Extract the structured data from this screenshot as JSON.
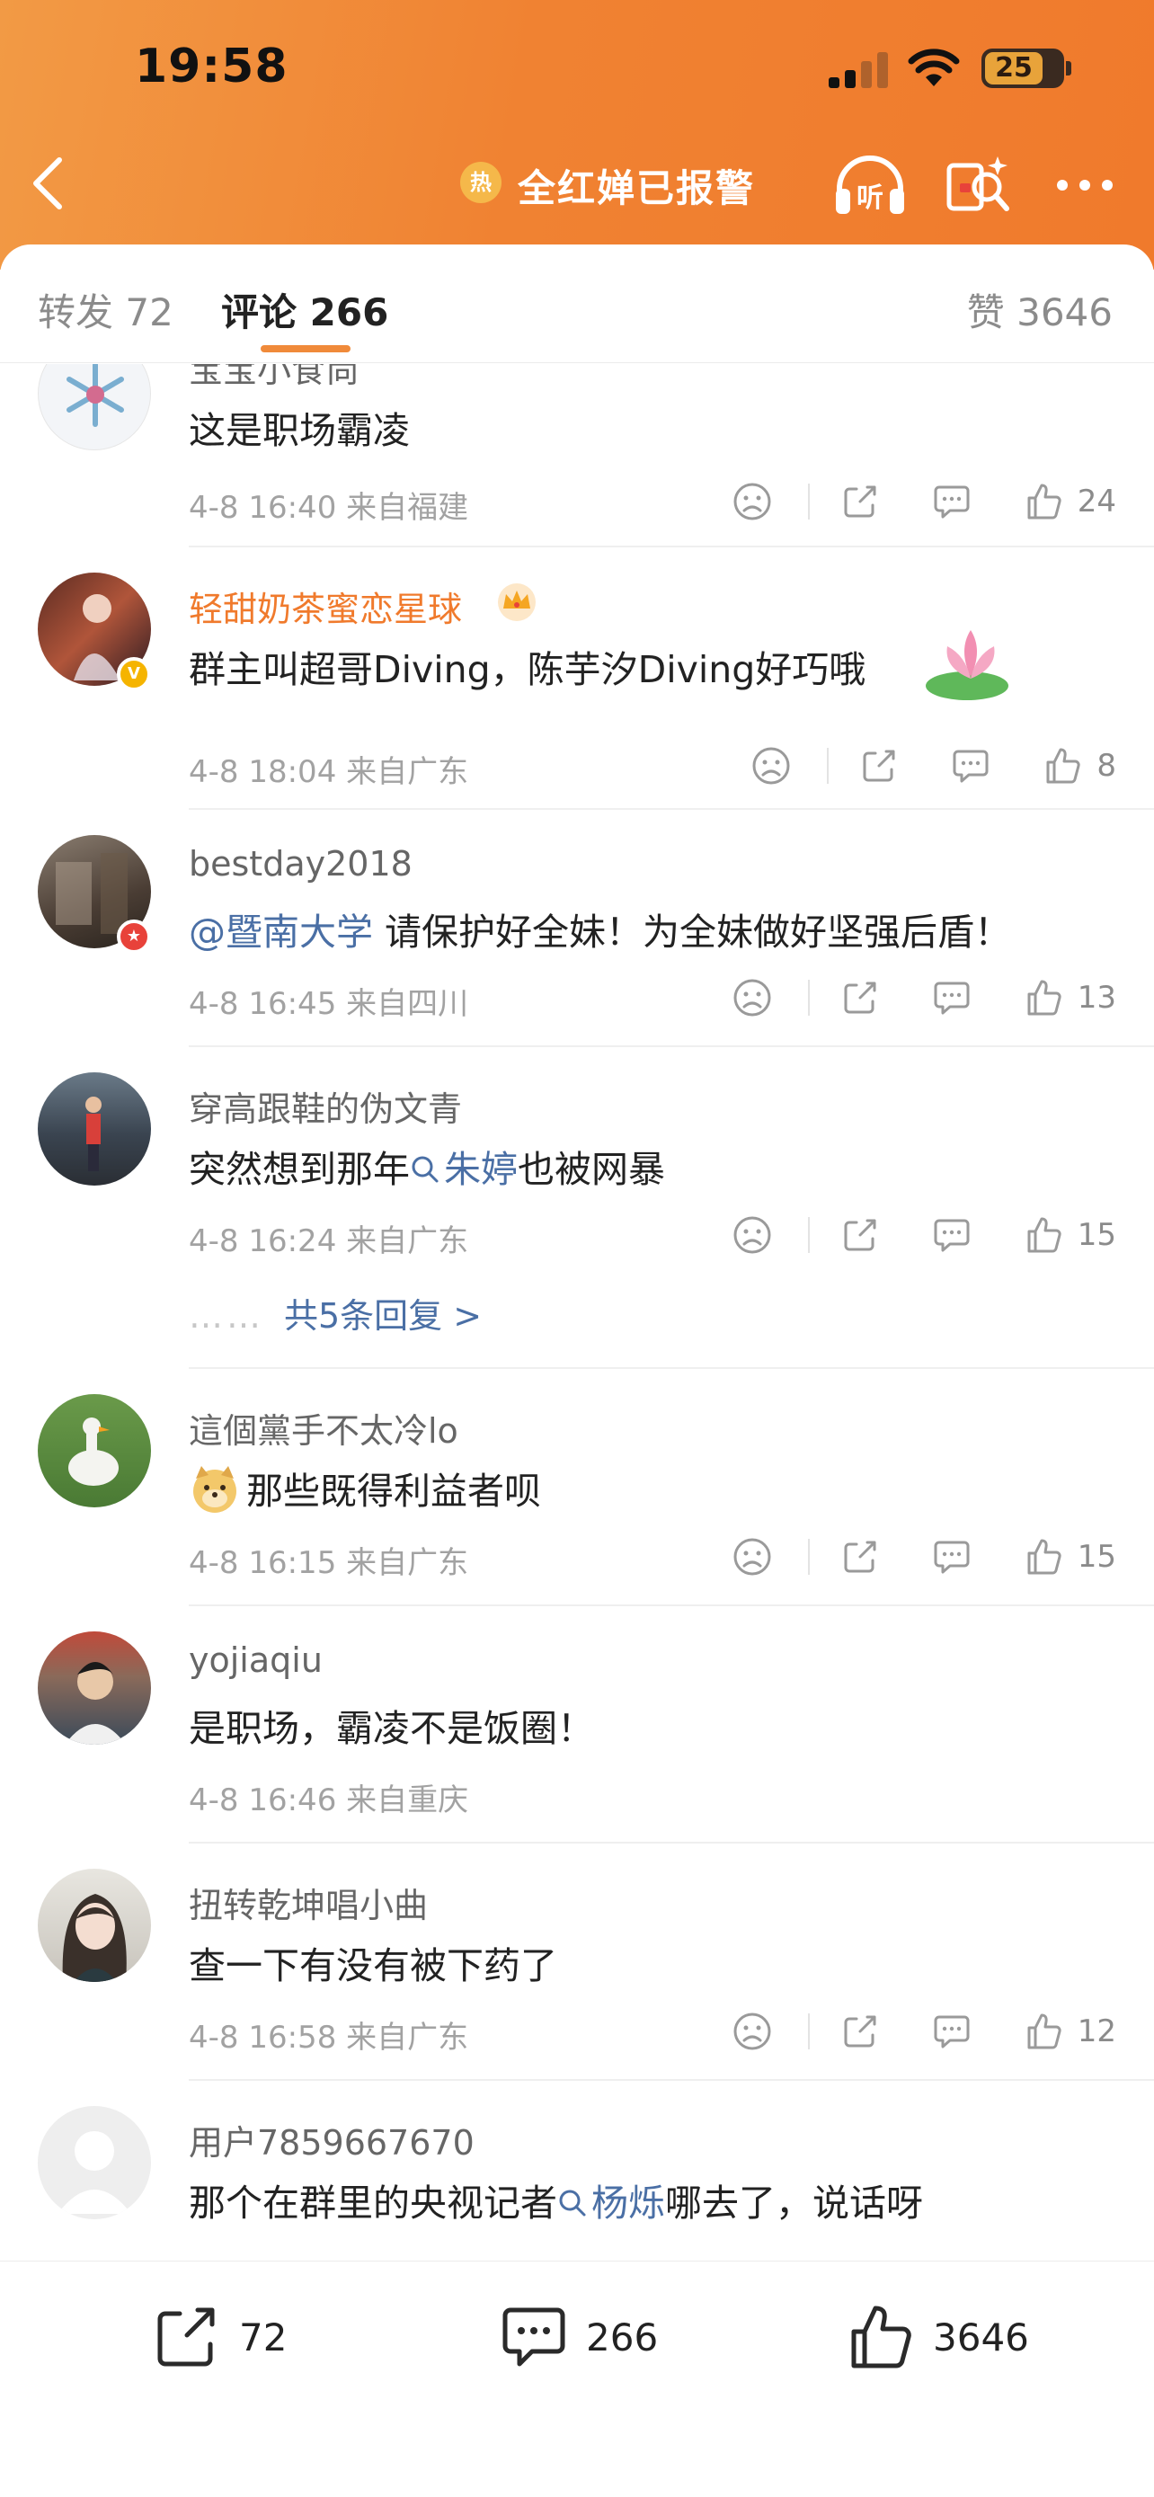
{
  "status_bar": {
    "time": "19:58",
    "battery": "25"
  },
  "nav": {
    "title": "全红婵已报警",
    "hot_badge": "热",
    "listen_icon": "listen-headphones-icon",
    "more_icon": "more-dots-icon"
  },
  "tabs": {
    "forward": "转发 72",
    "comment": "评论 266",
    "like": "赞 3646"
  },
  "comments": [
    {
      "user": "宝宝小食尚",
      "content": "这是职场霸凌",
      "meta": "4-8 16:40  来自福建",
      "likes": "24"
    },
    {
      "user": "轻甜奶茶蜜恋星球",
      "content": "群主叫超哥Diving，陈芋汐Diving好巧哦",
      "meta": "4-8 18:04  来自广东",
      "likes": "8"
    },
    {
      "user": "bestday2018",
      "mention": "@暨南大学",
      "content": " 请保护好全妹！为全妹做好坚强后盾！",
      "meta": "4-8 16:45  来自四川",
      "likes": "13"
    },
    {
      "user": "穿高跟鞋的伪文青",
      "content_pre": "突然想到那年",
      "topic": "朱婷",
      "content_post": "也被网暴",
      "meta": "4-8 16:24  来自广东",
      "likes": "15",
      "replies": "共5条回复 >"
    },
    {
      "user": "這個黨手不太冷lo",
      "content": "那些既得利益者呗",
      "meta": "4-8 16:15  来自广东",
      "likes": "15"
    },
    {
      "user": "yojiaqiu",
      "content": "是职场，霸凌不是饭圈！",
      "meta": "4-8 16:46  来自重庆"
    },
    {
      "user": "扭转乾坤唱小曲",
      "content": "查一下有没有被下药了",
      "meta": "4-8 16:58  来自广东",
      "likes": "12"
    },
    {
      "user": "用户7859667670",
      "content_pre": "那个在群里的央视记者",
      "topic": "杨烁",
      "content_post": "哪去了，说话呀"
    }
  ],
  "bottom_bar": {
    "forward_count": "72",
    "comment_count": "266",
    "like_count": "3646"
  },
  "colors": {
    "header": "#f08232",
    "accent": "#f08a3a",
    "link": "#4a6fa5"
  }
}
